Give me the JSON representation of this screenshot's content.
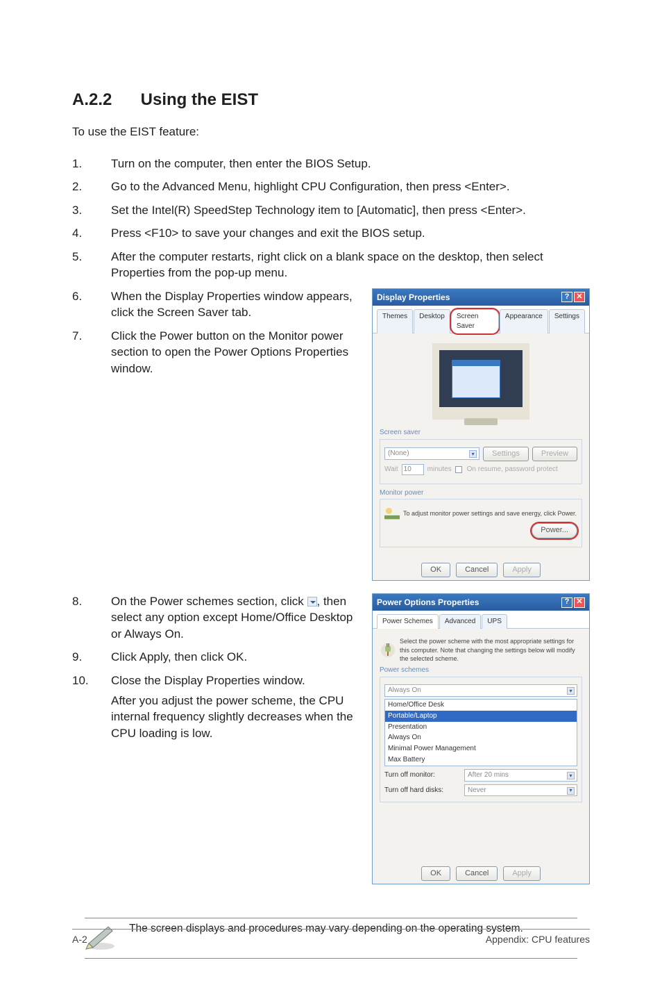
{
  "heading_number": "A.2.2",
  "heading_title": "Using the EIST",
  "intro": "To use the EIST feature:",
  "steps": [
    {
      "num": "1.",
      "text": "Turn on the computer, then enter the BIOS Setup."
    },
    {
      "num": "2.",
      "text": "Go to the Advanced Menu, highlight CPU Configuration, then press <Enter>."
    },
    {
      "num": "3.",
      "text": "Set the Intel(R) SpeedStep Technology item to [Automatic], then press <Enter>."
    },
    {
      "num": "4.",
      "text": "Press <F10> to save your changes and exit the BIOS setup."
    },
    {
      "num": "5.",
      "text": "After the computer restarts, right click on a blank space on the desktop, then select Properties from the pop-up menu."
    },
    {
      "num": "6.",
      "text": "When the Display Properties window appears, click the Screen Saver tab."
    },
    {
      "num": "7.",
      "text": "Click the Power button on the Monitor power section to open the Power Options Properties window."
    },
    {
      "num": "8.",
      "text_before": "On the Power schemes section, click ",
      "text_after": ", then select any option except Home/Office Desktop or Always On."
    },
    {
      "num": "9.",
      "text": "Click Apply, then click OK."
    },
    {
      "num": "10.",
      "text": "Close the Display Properties window.",
      "extra": "After you adjust the power scheme, the CPU internal frequency slightly decreases when the CPU loading is low."
    }
  ],
  "display_dialog": {
    "title": "Display Properties",
    "tabs": [
      "Themes",
      "Desktop",
      "Screen Saver",
      "Appearance",
      "Settings"
    ],
    "section_screensaver": "Screen saver",
    "select_value": "(None)",
    "btn_settings": "Settings",
    "btn_preview": "Preview",
    "wait_label": "Wait",
    "wait_value": "10",
    "wait_unit": "minutes",
    "resume_label": "On resume, password protect",
    "section_monitor": "Monitor power",
    "monitor_text": "To adjust monitor power settings and save energy, click Power.",
    "btn_power": "Power...",
    "ok": "OK",
    "cancel": "Cancel",
    "apply": "Apply"
  },
  "power_dialog": {
    "title": "Power Options Properties",
    "tabs": [
      "Power Schemes",
      "Advanced",
      "UPS"
    ],
    "desc": "Select the power scheme with the most appropriate settings for this computer. Note that changing the settings below will modify the selected scheme.",
    "section_schemes": "Power schemes",
    "scheme_value": "Always On",
    "scheme_options": [
      "Home/Office Desk",
      "Portable/Laptop",
      "Presentation",
      "Always On",
      "Minimal Power Management",
      "Max Battery"
    ],
    "turn_off_monitor_label": "Turn off monitor:",
    "turn_off_monitor_value": "After 20 mins",
    "turn_off_disks_label": "Turn off hard disks:",
    "turn_off_disks_value": "Never",
    "ok": "OK",
    "cancel": "Cancel",
    "apply": "Apply"
  },
  "note": "The screen displays and procedures may vary depending on the operating system.",
  "footer_left": "A-2",
  "footer_right": "Appendix: CPU features"
}
